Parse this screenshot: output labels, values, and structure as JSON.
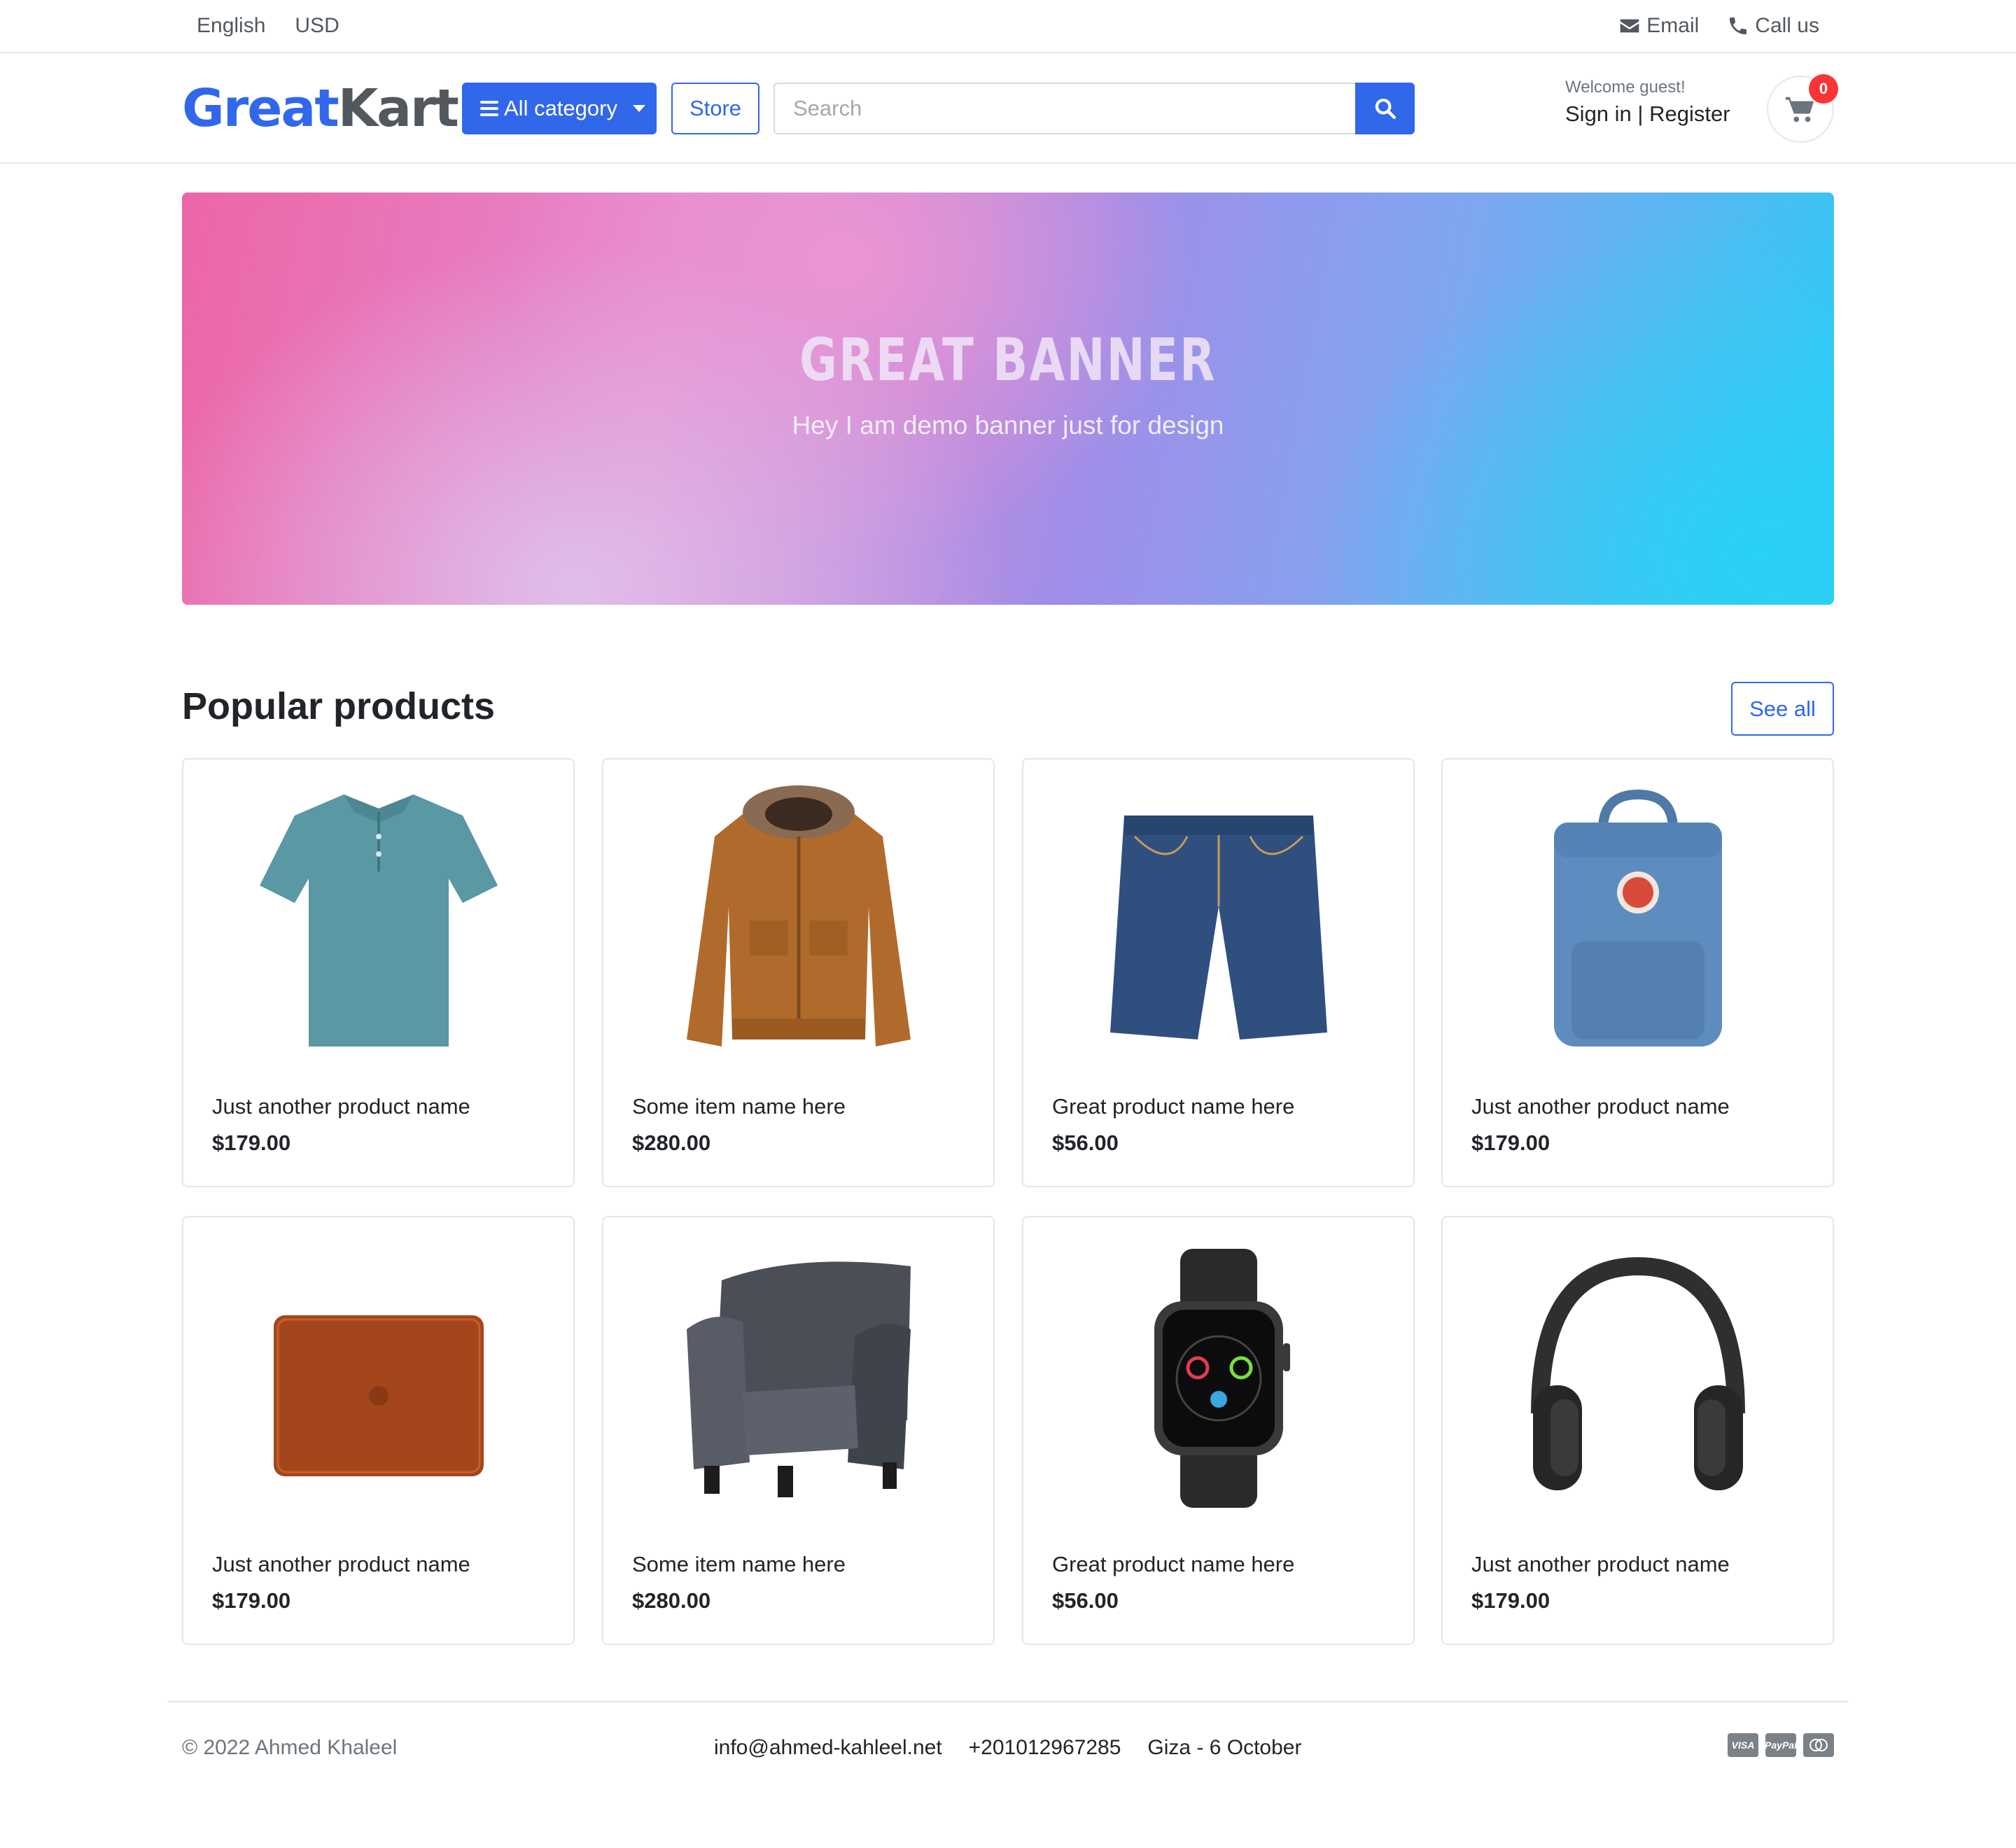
{
  "topbar": {
    "language": "English",
    "currency": "USD",
    "email_label": "Email",
    "call_label": "Call us"
  },
  "header": {
    "logo_part1": "Great",
    "logo_part2": "Kart",
    "category_button": "All category",
    "store_button": "Store",
    "search_placeholder": "Search",
    "welcome": "Welcome guest!",
    "sign_in": "Sign in",
    "separator": " | ",
    "register": "Register",
    "cart_count": "0"
  },
  "banner": {
    "title": "GREAT BANNER",
    "subtitle": "Hey I am demo banner just for design"
  },
  "popular": {
    "title": "Popular products",
    "see_all": "See all",
    "products": [
      {
        "name": "Just another product name",
        "price": "$179.00",
        "icon": "polo-shirt"
      },
      {
        "name": "Some item name here",
        "price": "$280.00",
        "icon": "jacket"
      },
      {
        "name": "Great product name here",
        "price": "$56.00",
        "icon": "denim-shorts"
      },
      {
        "name": "Just another product name",
        "price": "$179.00",
        "icon": "backpack"
      },
      {
        "name": "Just another product name",
        "price": "$179.00",
        "icon": "laptop-sleeve"
      },
      {
        "name": "Some item name here",
        "price": "$280.00",
        "icon": "armchair"
      },
      {
        "name": "Great product name here",
        "price": "$56.00",
        "icon": "smartwatch"
      },
      {
        "name": "Just another product name",
        "price": "$179.00",
        "icon": "headphones"
      }
    ]
  },
  "footer": {
    "copyright": "© 2022 Ahmed Khaleel",
    "email": "info@ahmed-kahleel.net",
    "phone": "+201012967285",
    "address": "Giza - 6 October",
    "payment": [
      "VISA",
      "PayPal",
      "MC"
    ]
  },
  "colors": {
    "primary": "#3167eb",
    "badge": "#fa3434",
    "muted_text": "#6c757d"
  }
}
